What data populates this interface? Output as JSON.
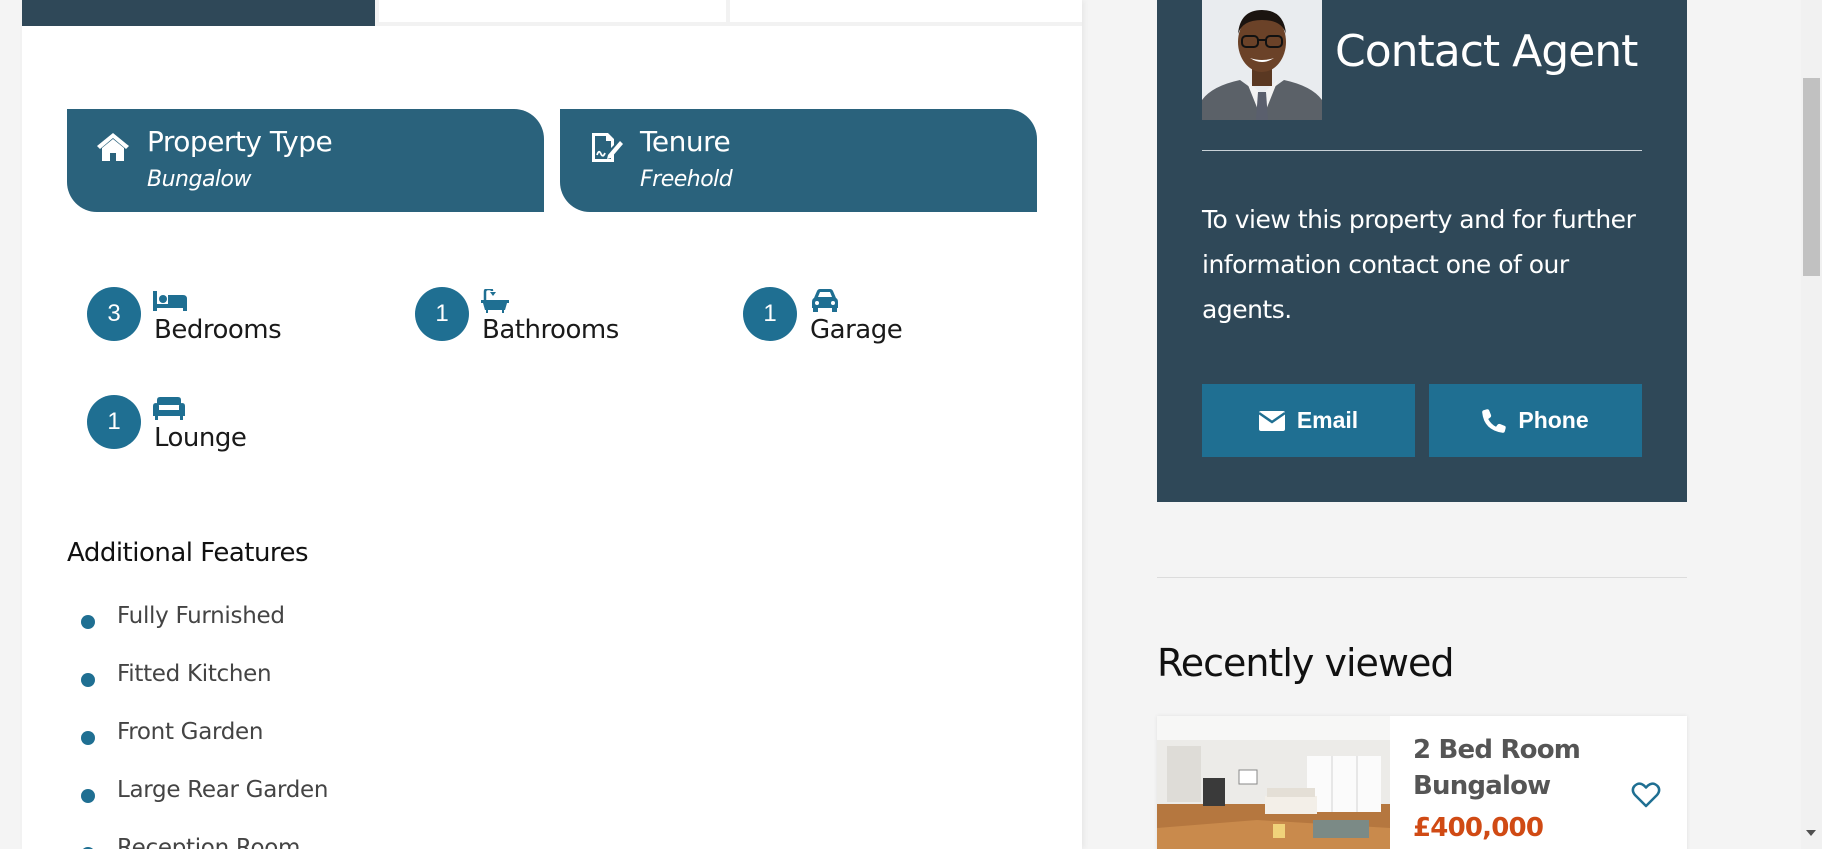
{
  "property_info": {
    "type_label": "Property Type",
    "type_value": "Bungalow",
    "tenure_label": "Tenure",
    "tenure_value": "Freehold"
  },
  "rooms": [
    {
      "count": "3",
      "label": "Bedrooms",
      "icon": "bed-icon"
    },
    {
      "count": "1",
      "label": "Bathrooms",
      "icon": "bath-icon"
    },
    {
      "count": "1",
      "label": "Garage",
      "icon": "car-icon"
    },
    {
      "count": "1",
      "label": "Lounge",
      "icon": "sofa-icon"
    }
  ],
  "features": {
    "title": "Additional Features",
    "items": [
      "Fully Furnished",
      "Fitted Kitchen",
      "Front Garden",
      "Large Rear Garden",
      "Reception Room"
    ]
  },
  "agent": {
    "title": "Contact Agent",
    "text": "To view this property and for further information contact one of our agents.",
    "email_label": "Email",
    "phone_label": "Phone"
  },
  "recently_viewed": {
    "title": "Recently viewed",
    "items": [
      {
        "name": "2 Bed Room Bungalow",
        "price": "£400,000"
      }
    ]
  },
  "colors": {
    "pill": "#2a627c",
    "accent": "#1f6f92",
    "dark_panel": "#2f4858",
    "price": "#d04a14"
  }
}
